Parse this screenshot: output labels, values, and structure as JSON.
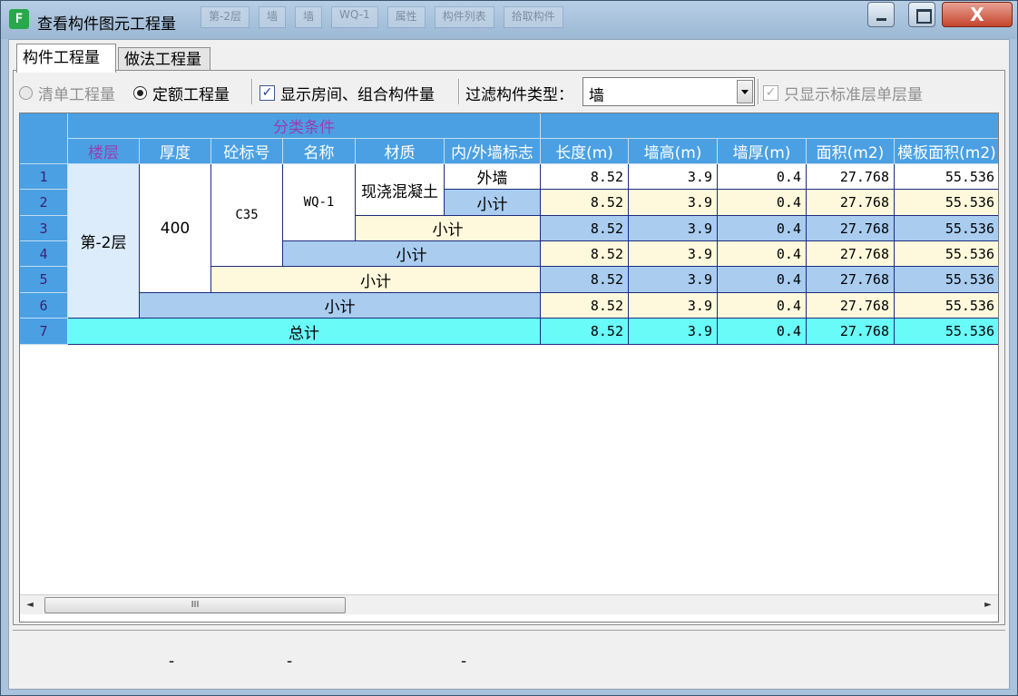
{
  "window": {
    "title": "查看构件图元工程量",
    "app_icon_glyph": "F",
    "close_glyph": "X"
  },
  "ghost_toolbar": [
    "第-2层",
    "墙",
    "墙",
    "WQ-1",
    "属性",
    "构件列表",
    "拾取构件"
  ],
  "tabs": [
    {
      "label": "构件工程量",
      "active": true
    },
    {
      "label": "做法工程量",
      "active": false
    }
  ],
  "toolbar": {
    "radio_bill": "清单工程量",
    "radio_quota": "定额工程量",
    "check_rooms": "显示房间、组合构件量",
    "filter_label": "过滤构件类型：",
    "filter_value": "墙",
    "check_std_floor": "只显示标准层单层量",
    "check_glyph": "✓"
  },
  "table": {
    "group_header": "分类条件",
    "columns": [
      "楼层",
      "厚度",
      "砼标号",
      "名称",
      "材质",
      "内/外墙标志",
      "长度(m)",
      "墙高(m)",
      "墙厚(m)",
      "面积(m2)",
      "模板面积(m2)"
    ],
    "row_numbers": [
      "1",
      "2",
      "3",
      "4",
      "5",
      "6",
      "7"
    ],
    "floor": "第-2层",
    "thickness": "400",
    "concrete": "C35",
    "name": "WQ-1",
    "material": "现浇混凝土",
    "wall_flag": "外墙",
    "subtotal": "小计",
    "total": "总计",
    "values": [
      [
        "8.52",
        "3.9",
        "0.4",
        "27.768",
        "55.536"
      ],
      [
        "8.52",
        "3.9",
        "0.4",
        "27.768",
        "55.536"
      ],
      [
        "8.52",
        "3.9",
        "0.4",
        "27.768",
        "55.536"
      ],
      [
        "8.52",
        "3.9",
        "0.4",
        "27.768",
        "55.536"
      ],
      [
        "8.52",
        "3.9",
        "0.4",
        "27.768",
        "55.536"
      ],
      [
        "8.52",
        "3.9",
        "0.4",
        "27.768",
        "55.536"
      ],
      [
        "8.52",
        "3.9",
        "0.4",
        "27.768",
        "55.536"
      ]
    ]
  },
  "scrollbar": {
    "left_glyph": "◄",
    "right_glyph": "►",
    "thumb_glyph": "III"
  },
  "status": [
    "-",
    "-",
    "-"
  ],
  "colors": {
    "header": "#4aa0e3",
    "subtotal_yellow": "#fef9dc",
    "subtotal_blue": "#a9ccef",
    "total_cyan": "#69fbf8"
  }
}
